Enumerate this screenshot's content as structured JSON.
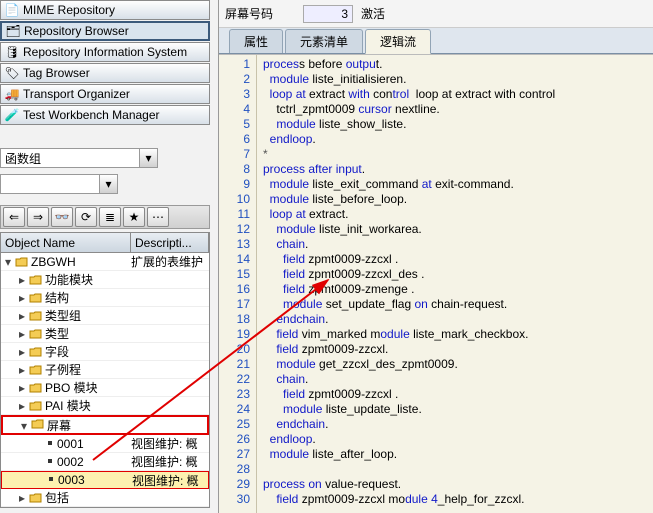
{
  "nav": {
    "items": [
      {
        "label": "MIME Repository"
      },
      {
        "label": "Repository Browser"
      },
      {
        "label": "Repository Information System"
      },
      {
        "label": "Tag Browser"
      },
      {
        "label": "Transport Organizer"
      },
      {
        "label": "Test Workbench Manager"
      }
    ]
  },
  "filter": {
    "label": "函数组",
    "dummy": ""
  },
  "grid": {
    "h1": "Object Name",
    "h2": "Descripti...",
    "root": "ZBGWH",
    "rootdesc": "扩展的表维护",
    "nodes": [
      {
        "l": "功能模块"
      },
      {
        "l": "结构"
      },
      {
        "l": "类型组"
      },
      {
        "l": "类型"
      },
      {
        "l": "字段"
      },
      {
        "l": "子例程"
      },
      {
        "l": "PBO 模块"
      },
      {
        "l": "PAI 模块"
      }
    ],
    "screens": {
      "l": "屏幕",
      "items": [
        {
          "n": "0001",
          "d": "视图维护: 概"
        },
        {
          "n": "0002",
          "d": "视图维护: 概"
        },
        {
          "n": "0003",
          "d": "视图维护: 概"
        }
      ]
    },
    "inc": {
      "l": "包括"
    }
  },
  "top": {
    "label": "屏幕号码",
    "value": "3",
    "act": "激活"
  },
  "tabs": {
    "t1": "属性",
    "t2": "元素清单",
    "t3": "逻辑流"
  },
  "code": [
    {
      "t": "process before output.",
      "k": [
        0,
        6,
        14,
        20
      ]
    },
    {
      "t": "  module liste_initialisieren.",
      "k": [
        2,
        8
      ]
    },
    {
      "t": "  loop at extract with control",
      "k": [
        2,
        6,
        7,
        9,
        18,
        22,
        26
      ]
    },
    {
      "t": "    tctrl_zpmt0009 cursor nextline.",
      "k": [
        19,
        25
      ]
    },
    {
      "t": "    module liste_show_liste.",
      "k": [
        4,
        10
      ]
    },
    {
      "t": "  endloop.",
      "k": [
        2,
        9
      ]
    },
    {
      "t": "*",
      "c": true
    },
    {
      "t": "process after input.",
      "k": [
        0,
        7,
        8,
        13,
        14,
        19
      ]
    },
    {
      "t": "  module liste_exit_command at exit-command.",
      "k": [
        2,
        8,
        28,
        30
      ]
    },
    {
      "t": "  module liste_before_loop.",
      "k": [
        2,
        8
      ]
    },
    {
      "t": "  loop at extract.",
      "k": [
        2,
        6,
        7,
        9
      ]
    },
    {
      "t": "    module liste_init_workarea.",
      "k": [
        4,
        10
      ]
    },
    {
      "t": "    chain.",
      "k": [
        4,
        9
      ]
    },
    {
      "t": "      field zpmt0009-zzcxl .",
      "k": [
        6,
        11
      ]
    },
    {
      "t": "      field zpmt0009-zzcxl_des .",
      "k": [
        6,
        11
      ]
    },
    {
      "t": "      field zpmt0009-zmenge .",
      "k": [
        6,
        11
      ]
    },
    {
      "t": "      module set_update_flag on chain-request.",
      "k": [
        6,
        12,
        29,
        31
      ]
    },
    {
      "t": "    endchain.",
      "k": [
        4,
        12
      ]
    },
    {
      "t": "    field vim_marked module liste_mark_checkbox.",
      "k": [
        4,
        9,
        22,
        28
      ]
    },
    {
      "t": "    field zpmt0009-zzcxl.",
      "k": [
        4,
        9
      ]
    },
    {
      "t": "    module get_zzcxl_des_zpmt0009.",
      "k": [
        4,
        10
      ]
    },
    {
      "t": "    chain.",
      "k": [
        4,
        9
      ]
    },
    {
      "t": "      field zpmt0009-zzcxl .",
      "k": [
        6,
        11
      ]
    },
    {
      "t": "      module liste_update_liste.",
      "k": [
        6,
        12
      ]
    },
    {
      "t": "    endchain.",
      "k": [
        4,
        12
      ]
    },
    {
      "t": "  endloop.",
      "k": [
        2,
        9
      ]
    },
    {
      "t": "  module liste_after_loop.",
      "k": [
        2,
        8
      ]
    },
    {
      "t": "",
      "c": true
    },
    {
      "t": "process on value-request.",
      "k": [
        0,
        7,
        8,
        10
      ]
    },
    {
      "t": "    field zpmt0009-zzcxl module 4_help_for_zzcxl.",
      "k": [
        4,
        9,
        27,
        33
      ]
    }
  ]
}
